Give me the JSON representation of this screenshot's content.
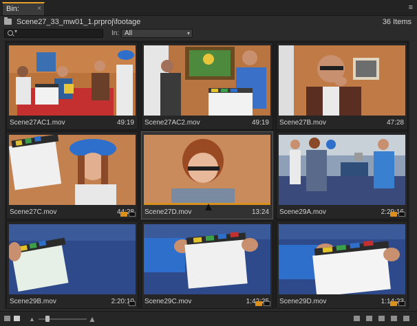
{
  "tab": {
    "title": "Bin: footage",
    "close": "×"
  },
  "panel_menu": "≡",
  "path": {
    "text": "Scene27_33_mw01_1.prproj\\footage",
    "count": "36 Items"
  },
  "filter": {
    "search_placeholder": "",
    "in_label": "In:",
    "in_value": "All"
  },
  "clips": [
    {
      "name": "Scene27AC1.mov",
      "duration": "49:19"
    },
    {
      "name": "Scene27AC2.mov",
      "duration": "49:19"
    },
    {
      "name": "Scene27B.mov",
      "duration": "47:28"
    },
    {
      "name": "Scene27C.mov",
      "duration": "44:28"
    },
    {
      "name": "Scene27D.mov",
      "duration": "13:24"
    },
    {
      "name": "Scene29A.mov",
      "duration": "2:29:16"
    },
    {
      "name": "Scene29B.mov",
      "duration": "2:20:10"
    },
    {
      "name": "Scene29C.mov",
      "duration": "1:42:25"
    },
    {
      "name": "Scene29D.mov",
      "duration": "1:14:23"
    }
  ],
  "colors": {
    "accent": "#e8a22b",
    "badge": "#d9901c"
  }
}
